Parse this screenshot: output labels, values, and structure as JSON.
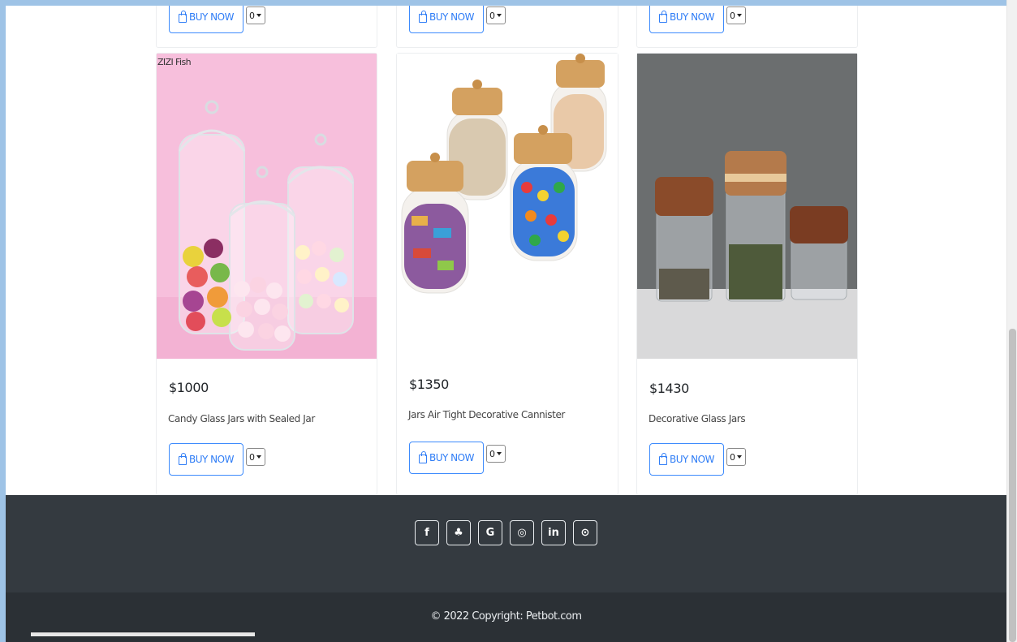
{
  "products_previous_row": [
    {
      "buy_label": "BUY NOW",
      "qty": "0"
    },
    {
      "buy_label": "BUY NOW",
      "qty": "0"
    },
    {
      "buy_label": "BUY NOW",
      "qty": "0"
    }
  ],
  "products": [
    {
      "brand_tag": "ZIZI Fish",
      "price": "$1000",
      "name": "Candy Glass Jars with Sealed Jar",
      "buy_label": "BUY NOW",
      "qty": "0"
    },
    {
      "brand_tag": "",
      "price": "$1350",
      "name": "Jars Air Tight Decorative Cannister",
      "buy_label": "BUY NOW",
      "qty": "0"
    },
    {
      "brand_tag": "",
      "price": "$1430",
      "name": "Decorative Glass Jars",
      "buy_label": "BUY NOW",
      "qty": "0"
    }
  ],
  "footer": {
    "social_icons": [
      "facebook-icon",
      "twitter-icon",
      "google-icon",
      "instagram-icon",
      "linkedin-icon",
      "github-icon"
    ],
    "social_glyphs": [
      "f",
      "♣",
      "G",
      "◎",
      "in",
      "⊙"
    ],
    "copyright": "© 2022 Copyright: Petbot.com"
  },
  "colors": {
    "accent": "#2f7df6",
    "footer_bg": "#343a40",
    "footer_bottom_bg": "#2b3035",
    "page_frame": "#9ec3e6"
  }
}
